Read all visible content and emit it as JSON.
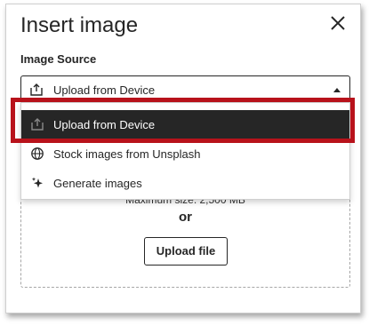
{
  "dialog": {
    "title": "Insert image",
    "close_icon": "close-icon"
  },
  "image_source": {
    "label": "Image Source",
    "selected_value": "Upload from Device",
    "options": [
      {
        "label": "Upload from Device",
        "icon": "upload-icon",
        "selected": true
      },
      {
        "label": "Stock images from Unsplash",
        "icon": "globe-icon",
        "selected": false
      },
      {
        "label": "Generate images",
        "icon": "sparkle-icon",
        "selected": false
      }
    ]
  },
  "dropzone": {
    "max_size_text": "Maximum size: 2,500 MB",
    "or_text": "or",
    "upload_button_label": "Upload file"
  },
  "colors": {
    "highlight": "#b8121b",
    "selected_item_bg": "#262626"
  }
}
